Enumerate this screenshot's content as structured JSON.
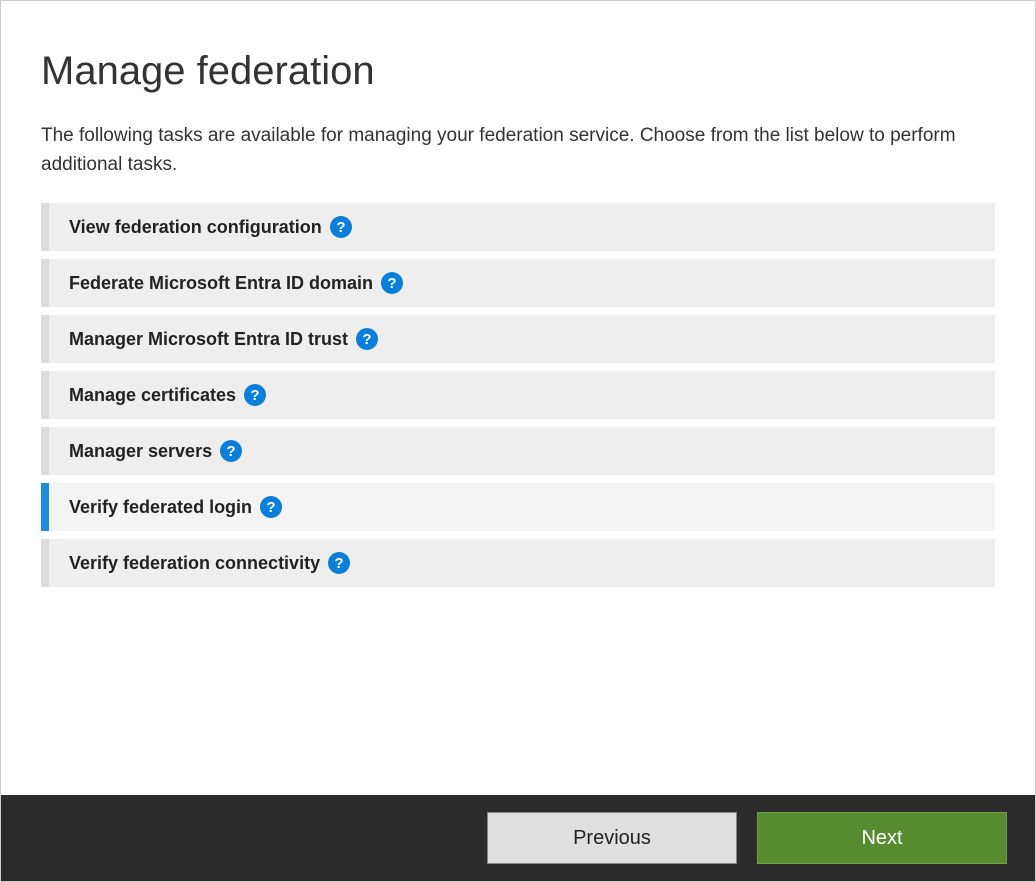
{
  "title": "Manage federation",
  "description": "The following tasks are available for managing your federation service.  Choose from the list below to perform additional tasks.",
  "tasks": [
    {
      "label": "View federation configuration",
      "selected": false
    },
    {
      "label": "Federate Microsoft Entra ID domain",
      "selected": false
    },
    {
      "label": "Manager Microsoft Entra ID trust",
      "selected": false
    },
    {
      "label": "Manage certificates",
      "selected": false
    },
    {
      "label": "Manager servers",
      "selected": false
    },
    {
      "label": "Verify federated login",
      "selected": true
    },
    {
      "label": "Verify federation connectivity",
      "selected": false
    }
  ],
  "buttons": {
    "previous": "Previous",
    "next": "Next"
  }
}
